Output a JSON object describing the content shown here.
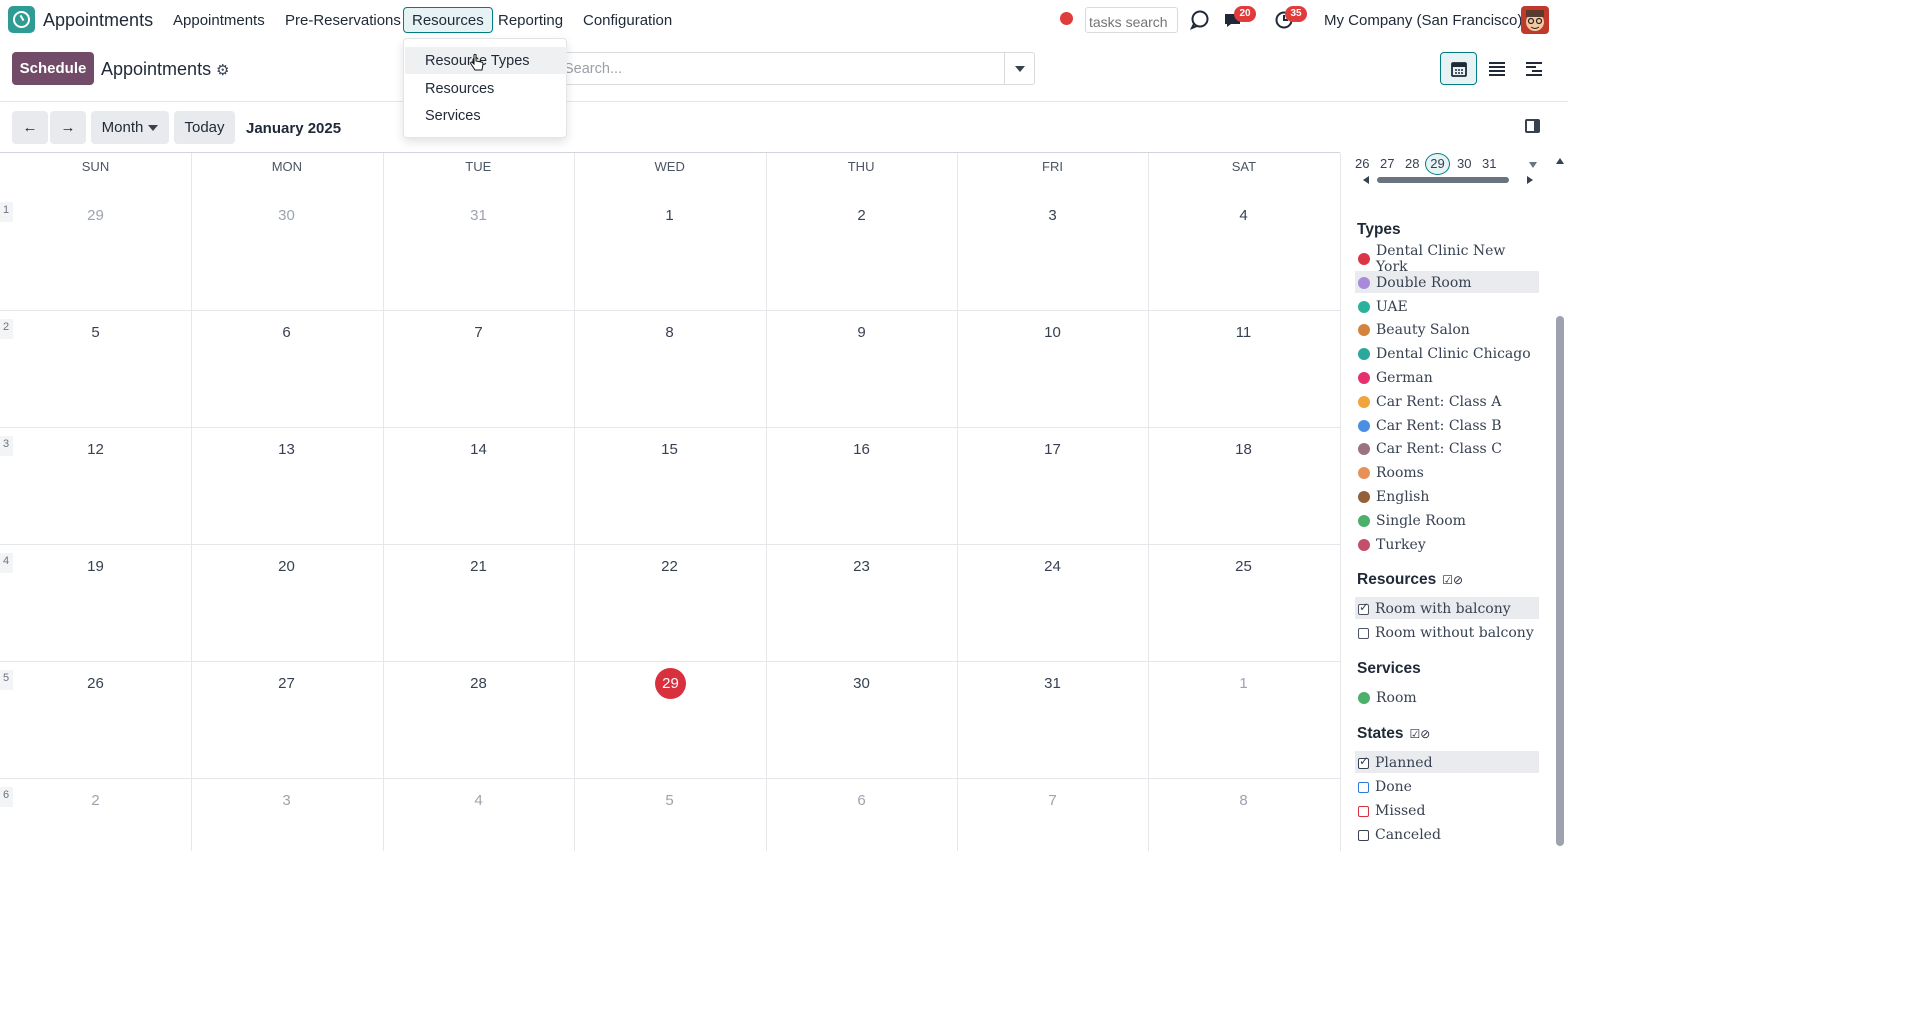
{
  "navbar": {
    "app_name": "Appointments",
    "menu": [
      "Appointments",
      "Pre-Reservations",
      "Resources",
      "Reporting",
      "Configuration"
    ],
    "active_menu": "Resources",
    "tasks_search_placeholder": "tasks search",
    "messages_badge": "20",
    "activities_badge": "35",
    "company": "My Company (San Francisco)"
  },
  "resources_dropdown": {
    "items": [
      "Resource Types",
      "Resources",
      "Services"
    ],
    "hovered": "Resource Types"
  },
  "control_panel": {
    "schedule_label": "Schedule",
    "title": "Appointments",
    "search_placeholder": "Search...",
    "views": [
      "calendar-icon",
      "list-icon",
      "gantt-icon"
    ],
    "active_view": "calendar"
  },
  "calendar": {
    "scale_label": "Month",
    "today_label": "Today",
    "period": "January 2025",
    "weekdays": [
      "SUN",
      "MON",
      "TUE",
      "WED",
      "THU",
      "FRI",
      "SAT"
    ],
    "weeks": [
      {
        "num": "1",
        "days": [
          "29",
          "30",
          "31",
          "1",
          "2",
          "3",
          "4"
        ]
      },
      {
        "num": "2",
        "days": [
          "5",
          "6",
          "7",
          "8",
          "9",
          "10",
          "11"
        ]
      },
      {
        "num": "3",
        "days": [
          "12",
          "13",
          "14",
          "15",
          "16",
          "17",
          "18"
        ]
      },
      {
        "num": "4",
        "days": [
          "19",
          "20",
          "21",
          "22",
          "23",
          "24",
          "25"
        ]
      },
      {
        "num": "5",
        "days": [
          "26",
          "27",
          "28",
          "29",
          "30",
          "31",
          "1"
        ]
      },
      {
        "num": "6",
        "days": [
          "2",
          "3",
          "4",
          "5",
          "6",
          "7",
          "8"
        ]
      }
    ],
    "today": "29"
  },
  "sidebar": {
    "mini_days": [
      "26",
      "27",
      "28",
      "29",
      "30",
      "31"
    ],
    "mini_today": "29",
    "types_title": "Types",
    "types": [
      {
        "label": "Dental Clinic New York",
        "color": "#dc3545"
      },
      {
        "label": "Double Room",
        "color": "#a78bda"
      },
      {
        "label": "UAE",
        "color": "#2bb29c"
      },
      {
        "label": "Beauty Salon",
        "color": "#d4843e"
      },
      {
        "label": "Dental Clinic Chicago",
        "color": "#2aa89b"
      },
      {
        "label": "German",
        "color": "#e5306b"
      },
      {
        "label": "Car Rent: Class A",
        "color": "#f0a43c"
      },
      {
        "label": "Car Rent: Class B",
        "color": "#4a90e2"
      },
      {
        "label": "Car Rent: Class C",
        "color": "#9b7383"
      },
      {
        "label": "Rooms",
        "color": "#e6905a"
      },
      {
        "label": "English",
        "color": "#94603a"
      },
      {
        "label": "Single Room",
        "color": "#4caf6a"
      },
      {
        "label": "Turkey",
        "color": "#c3506a"
      }
    ],
    "resources_title": "Resources",
    "resources": [
      {
        "label": "Room with balcony",
        "checked": true
      },
      {
        "label": "Room without balcony",
        "checked": false
      }
    ],
    "services_title": "Services",
    "services": [
      {
        "label": "Room",
        "color": "#4caf6a"
      }
    ],
    "states_title": "States",
    "states": [
      {
        "label": "Planned",
        "checked": true,
        "color": "#374151"
      },
      {
        "label": "Done",
        "checked": false,
        "color": "#2f7ad9"
      },
      {
        "label": "Missed",
        "checked": false,
        "color": "#d9303e"
      },
      {
        "label": "Canceled",
        "checked": false,
        "color": "#374151"
      }
    ]
  }
}
